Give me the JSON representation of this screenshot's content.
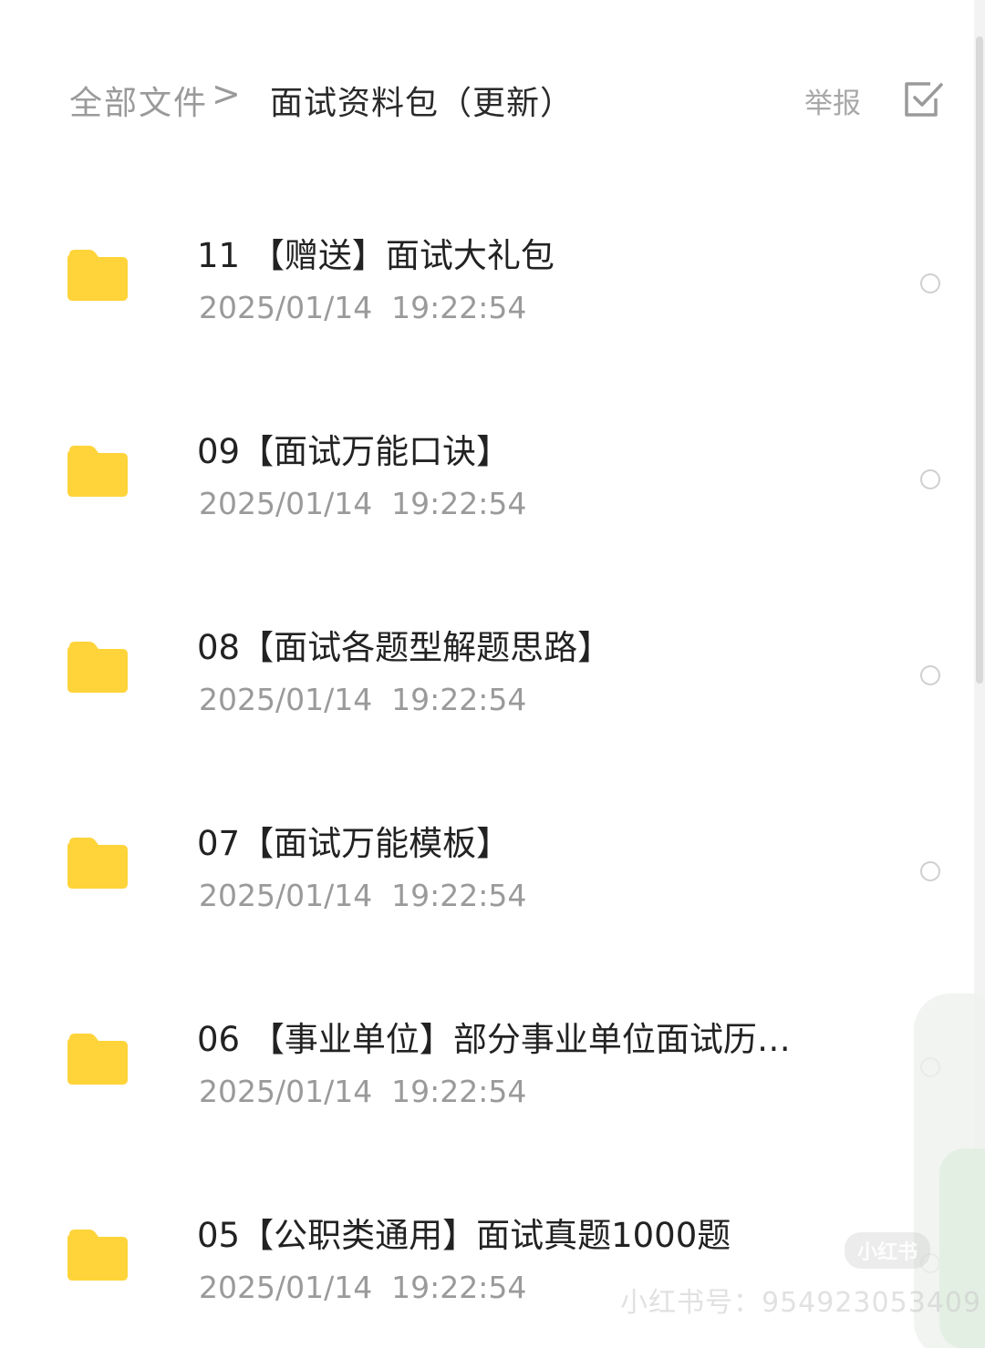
{
  "header": {
    "breadcrumb_root": "全部文件",
    "breadcrumb_separator": ">",
    "breadcrumb_current": "面试资料包（更新）",
    "report_label": "举报"
  },
  "files": [
    {
      "name": "11 【赠送】面试大礼包",
      "time": "2025/01/14  19:22:54"
    },
    {
      "name": "09【面试万能口诀】",
      "time": "2025/01/14  19:22:54"
    },
    {
      "name": "08【面试各题型解题思路】",
      "time": "2025/01/14  19:22:54"
    },
    {
      "name": "07【面试万能模板】",
      "time": "2025/01/14  19:22:54"
    },
    {
      "name": "06 【事业单位】部分事业单位面试历…",
      "time": "2025/01/14  19:22:54"
    },
    {
      "name": "05【公职类通用】面试真题1000题",
      "time": "2025/01/14  19:22:54"
    }
  ],
  "watermark": {
    "logo_text": "小红书",
    "id_text": "小红书号：954923053409"
  },
  "colors": {
    "folder": "#FFD43B",
    "text_primary": "#222222",
    "text_secondary": "#9a9a9a",
    "radio_border": "#cfcfcf"
  },
  "icons": {
    "select": "checkbox-select-icon",
    "folder": "folder-icon",
    "radio": "radio-unchecked-icon"
  }
}
